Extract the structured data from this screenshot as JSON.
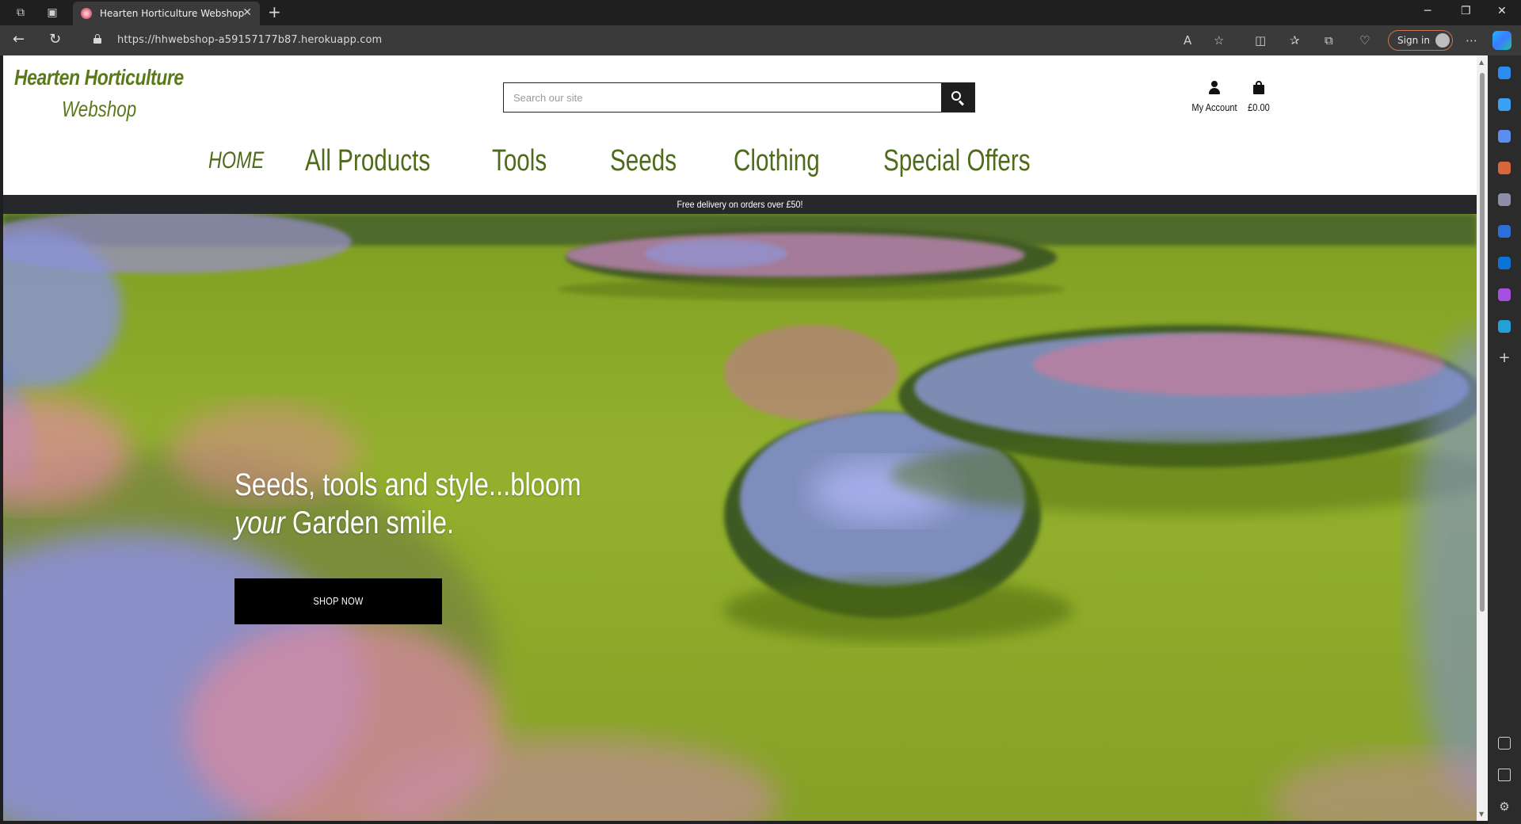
{
  "browser": {
    "tab_title": "Hearten Horticulture Webshop",
    "url": "https://hhwebshop-a59157177b87.herokuapp.com",
    "signin_label": "Sign in"
  },
  "site": {
    "logo_line1": "Hearten Horticulture",
    "logo_line2": "Webshop",
    "search_placeholder": "Search our site",
    "account_label": "My Account",
    "bag_total": "£0.00",
    "nav": [
      "HOME",
      "All Products",
      "Tools",
      "Seeds",
      "Clothing",
      "Special Offers"
    ],
    "delivery_banner": "Free delivery on orders over £50!",
    "hero": {
      "line_a": "Seeds, tools and style...bloom ",
      "line_em": "your",
      "line_b": " Garden smile.",
      "button": "SHOP NOW"
    }
  },
  "colors": {
    "brand_green": "#4e6b1a",
    "banner_bg": "#26282b",
    "button_bg": "#000000",
    "lawn": "#8aa82a"
  },
  "icons": {
    "search": "magnifier",
    "account": "user",
    "bag": "shopping-bag"
  }
}
